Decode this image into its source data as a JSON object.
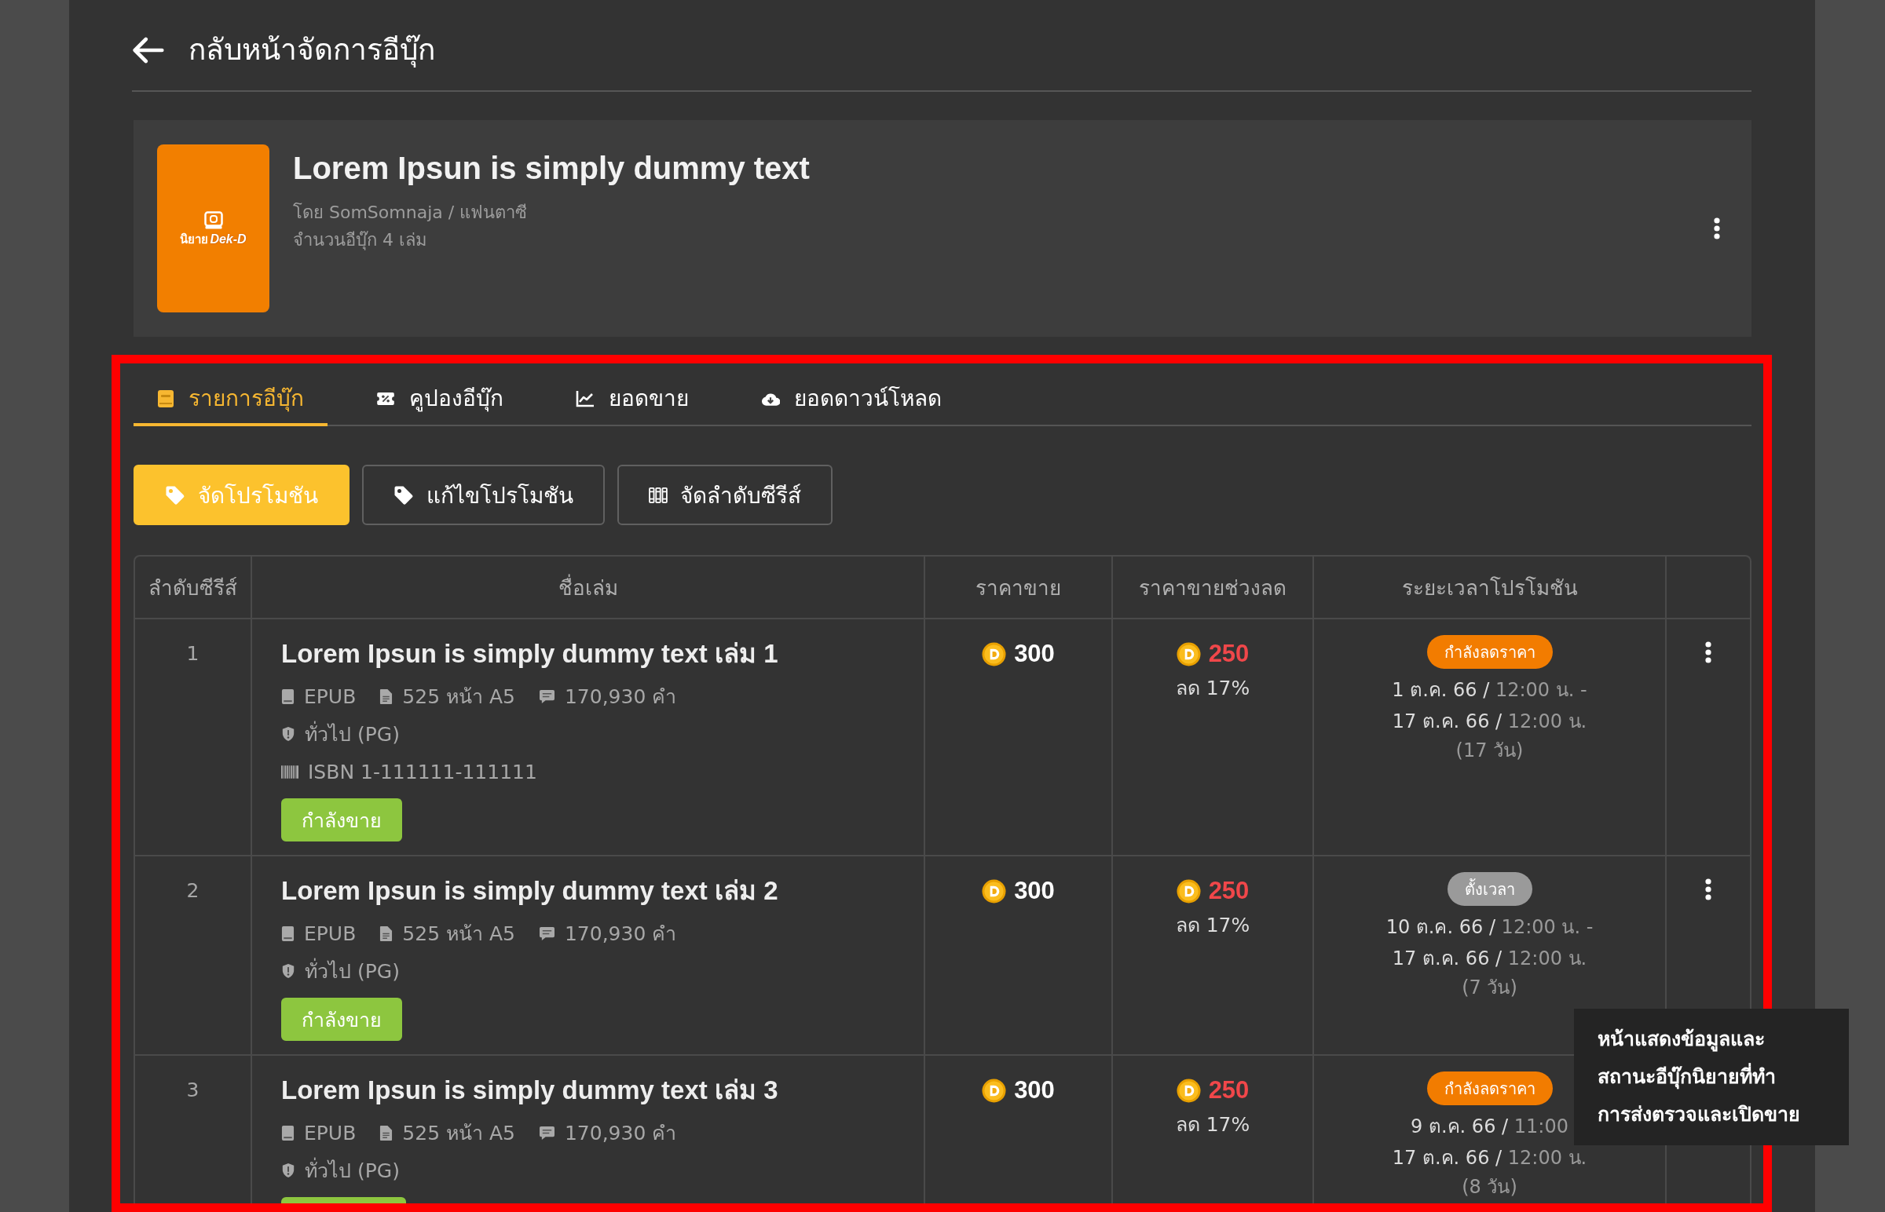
{
  "header": {
    "title": "กลับหน้าจัดการอีบุ๊ก"
  },
  "book": {
    "cover": {
      "logo_thai": "นิยาย",
      "logo_latin": "Dek-D"
    },
    "title": "Lorem Ipsun is simply dummy text",
    "byline": "โดย SomSomnaja / แฟนตาซี",
    "count": "จำนวนอีบุ๊ก 4 เล่ม"
  },
  "tabs": [
    {
      "label": "รายการอีบุ๊ก",
      "selected": true
    },
    {
      "label": "คูปองอีบุ๊ก",
      "selected": false
    },
    {
      "label": "ยอดขาย",
      "selected": false
    },
    {
      "label": "ยอดดาวน์โหลด",
      "selected": false
    }
  ],
  "actions": [
    {
      "label": "จัดโปรโมชัน",
      "kind": "primary"
    },
    {
      "label": "แก้ไขโปรโมชัน",
      "kind": "outline"
    },
    {
      "label": "จัดลำดับซีรีส์",
      "kind": "outline"
    }
  ],
  "table": {
    "columns": [
      "ลำดับซีรีส์",
      "ชื่อเล่ม",
      "ราคาขาย",
      "ราคาขายช่วงลด",
      "ระยะเวลาโปรโมชัน"
    ],
    "rows": [
      {
        "order": "1",
        "title": "Lorem Ipsun is simply dummy text เล่ม 1",
        "format": "EPUB",
        "pages": "525 หน้า A5",
        "words": "170,930 คำ",
        "rating": "ทั่วไป (PG)",
        "isbn": "ISBN 1-111111-111111",
        "status": {
          "label": "กำลังขาย",
          "kind": "selling"
        },
        "price": "300",
        "sale_price": "250",
        "discount": "ลด 17%",
        "promotion": {
          "status": {
            "label": "กำลังลดราคา",
            "kind": "active"
          },
          "start_date": "1 ต.ค. 66 /",
          "start_time": "12:00 น. -",
          "end_date": "17 ต.ค. 66 /",
          "end_time": "12:00 น.",
          "duration": "(17 วัน)"
        },
        "menu": true
      },
      {
        "order": "2",
        "title": "Lorem Ipsun is simply dummy text เล่ม 2",
        "format": "EPUB",
        "pages": "525 หน้า A5",
        "words": "170,930 คำ",
        "rating": "ทั่วไป (PG)",
        "status": {
          "label": "กำลังขาย",
          "kind": "selling"
        },
        "price": "300",
        "sale_price": "250",
        "discount": "ลด 17%",
        "promotion": {
          "status": {
            "label": "ตั้งเวลา",
            "kind": "scheduled"
          },
          "start_date": "10 ต.ค. 66 /",
          "start_time": "12:00 น. -",
          "end_date": "17 ต.ค. 66 /",
          "end_time": "12:00 น.",
          "duration": "(7 วัน)"
        },
        "menu": true
      },
      {
        "order": "3",
        "title": "Lorem Ipsun is simply dummy text เล่ม 3",
        "format": "EPUB",
        "pages": "525 หน้า A5",
        "words": "170,930 คำ",
        "rating": "ทั่วไป (PG)",
        "status": {
          "kind": "selling"
        },
        "price": "300",
        "sale_price": "250",
        "discount": "ลด 17%",
        "promotion": {
          "status": {
            "label": "กำลังลดราคา",
            "kind": "active"
          },
          "start_date": "9 ต.ค. 66 /",
          "start_time": "11:00",
          "end_date": "17 ต.ค. 66 /",
          "end_time": "12:00 น.",
          "duration": "(8 วัน)"
        },
        "menu": false
      }
    ]
  },
  "note": {
    "lines": [
      "หน้าแสดงข้อมูลและ",
      "สถานะอีบุ๊กนิยายที่ทำ",
      "การส่งตรวจและเปิดขาย"
    ]
  }
}
